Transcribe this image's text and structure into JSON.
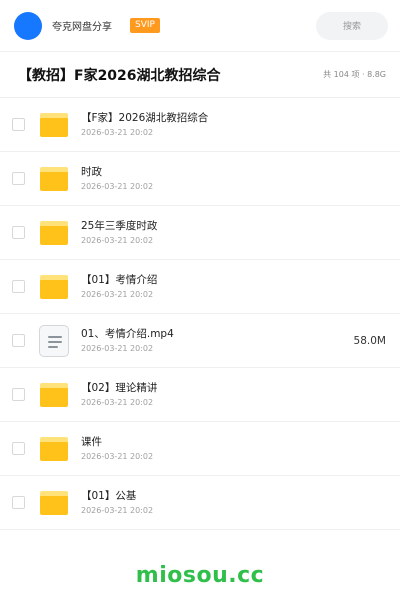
{
  "header": {
    "user_name": "夸克网盘分享",
    "vip_badge": "SVIP",
    "search_label": "搜索"
  },
  "share": {
    "title": "【教招】F家2026湖北教招综合",
    "meta": "共 104 项 · 8.8G"
  },
  "files": [
    {
      "type": "folder",
      "name": "【F家】2026湖北教招综合",
      "date": "2026-03-21 20:02",
      "size": ""
    },
    {
      "type": "folder",
      "name": "时政",
      "date": "2026-03-21 20:02",
      "size": ""
    },
    {
      "type": "folder",
      "name": "25年三季度时政",
      "date": "2026-03-21 20:02",
      "size": ""
    },
    {
      "type": "folder",
      "name": "【01】考情介绍",
      "date": "2026-03-21 20:02",
      "size": ""
    },
    {
      "type": "file",
      "name": "01、考情介绍.mp4",
      "date": "2026-03-21 20:02",
      "size": "58.0M"
    },
    {
      "type": "folder",
      "name": "【02】理论精讲",
      "date": "2026-03-21 20:02",
      "size": ""
    },
    {
      "type": "folder",
      "name": "课件",
      "date": "2026-03-21 20:02",
      "size": ""
    },
    {
      "type": "folder",
      "name": "【01】公基",
      "date": "2026-03-21 20:02",
      "size": ""
    }
  ],
  "watermark": "miosou.cc",
  "colors": {
    "accent": "#1677ff",
    "vip": "#ff9a1f",
    "folder": "#ffc21a",
    "watermark": "#2fbf4a"
  }
}
